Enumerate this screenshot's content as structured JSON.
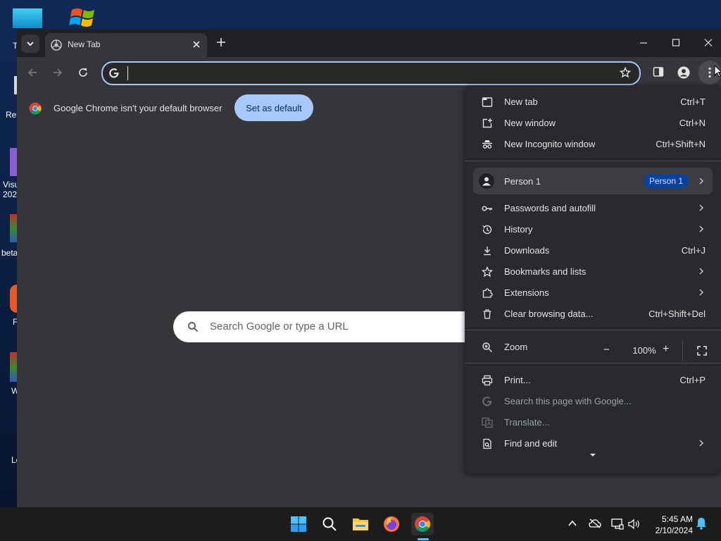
{
  "desktop": {
    "labels": [
      "T",
      "Re",
      "Visu",
      "202",
      "beta",
      "F",
      "W",
      "Le"
    ]
  },
  "browser": {
    "tab": {
      "title": "New Tab"
    },
    "omnibox": {
      "value": ""
    },
    "infobar": {
      "message": "Google Chrome isn't your default browser",
      "button": "Set as default"
    },
    "ntp": {
      "search_placeholder": "Search Google or type a URL"
    }
  },
  "menu": {
    "items": [
      {
        "icon": "new-tab-icon",
        "label": "New tab",
        "shortcut": "Ctrl+T"
      },
      {
        "icon": "new-window-icon",
        "label": "New window",
        "shortcut": "Ctrl+N"
      },
      {
        "icon": "incognito-icon",
        "label": "New Incognito window",
        "shortcut": "Ctrl+Shift+N"
      }
    ],
    "profile": {
      "name": "Person 1",
      "badge": "Person 1"
    },
    "items2": [
      {
        "icon": "key-icon",
        "label": "Passwords and autofill"
      },
      {
        "icon": "history-icon",
        "label": "History"
      },
      {
        "icon": "download-icon",
        "label": "Downloads",
        "shortcut": "Ctrl+J"
      },
      {
        "icon": "star-icon",
        "label": "Bookmarks and lists"
      },
      {
        "icon": "extensions-icon",
        "label": "Extensions"
      },
      {
        "icon": "trash-icon",
        "label": "Clear browsing data...",
        "shortcut": "Ctrl+Shift+Del"
      }
    ],
    "zoom": {
      "label": "Zoom",
      "value": "100%",
      "minus": "−",
      "plus": "+"
    },
    "items3": [
      {
        "icon": "print-icon",
        "label": "Print...",
        "shortcut": "Ctrl+P"
      },
      {
        "icon": "google-icon",
        "label": "Search this page with Google..."
      },
      {
        "icon": "translate-icon",
        "label": "Translate..."
      },
      {
        "icon": "find-icon",
        "label": "Find and edit"
      }
    ]
  },
  "taskbar": {
    "time": "5:45 AM",
    "date": "2/10/2024"
  },
  "colors": {
    "accent": "#a8c7fa",
    "menu_bg": "#292a2d",
    "badge_bg": "#0842a0"
  }
}
